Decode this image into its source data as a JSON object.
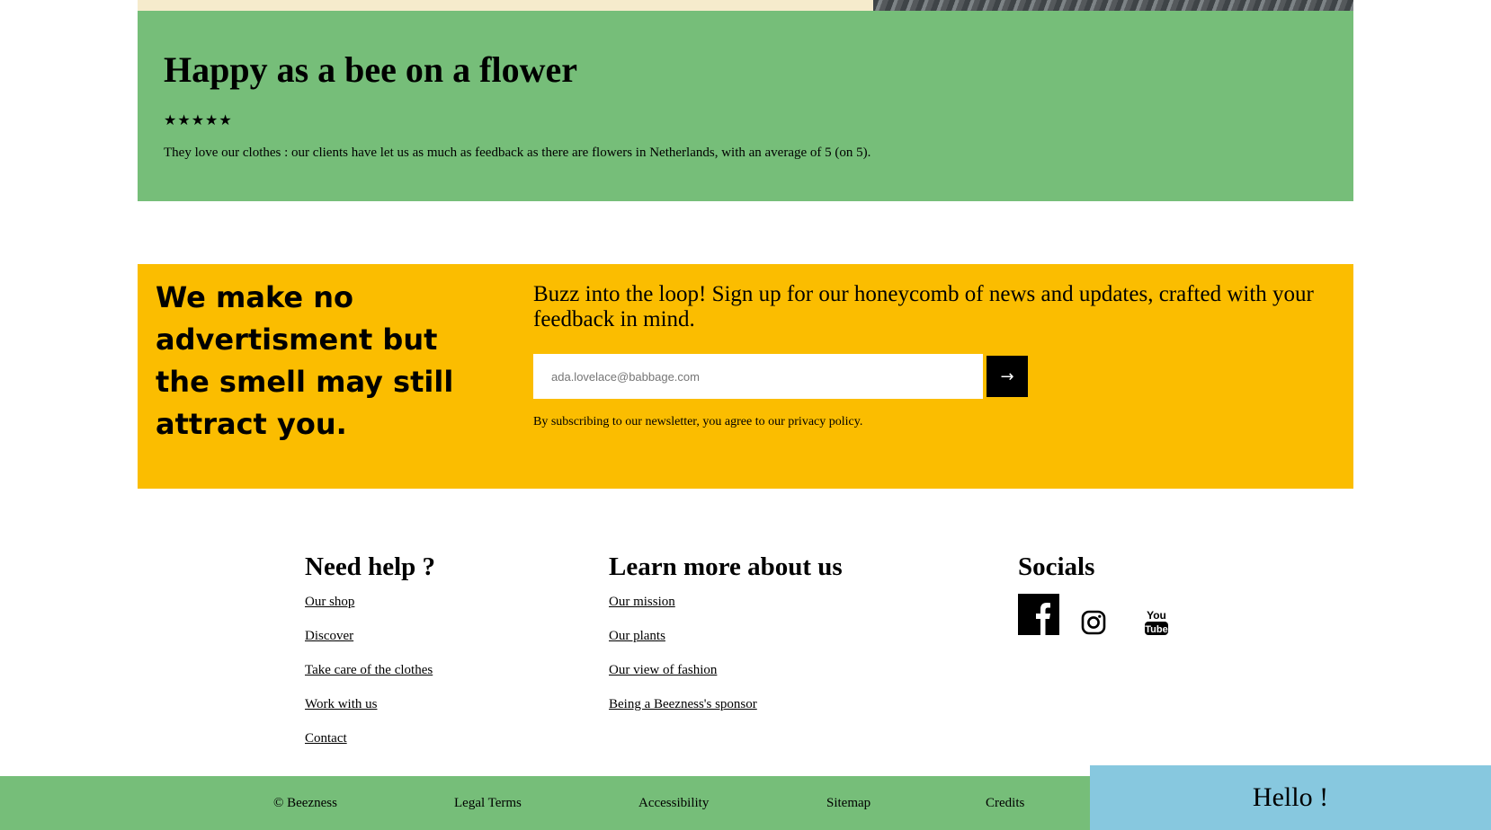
{
  "review": {
    "title": "Happy as a bee on a flower",
    "rating": 5,
    "stars": "★★★★★",
    "text": "They love our clothes : our clients have let us as much as feedback as there are flowers in Netherlands, with an average of 5 (on 5)."
  },
  "newsletter": {
    "headline": "We make no advertisment but the smell may still attract you.",
    "pitch": "Buzz into the loop! Sign up for our honeycomb of news and updates, crafted with your feedback in mind.",
    "email_placeholder": "ada.lovelace@babbage.com",
    "email_value": "",
    "submit_label": "→",
    "note": "By subscribing to our newsletter, you agree to our privacy policy."
  },
  "help": {
    "title": "Need help ?",
    "links": [
      "Our shop",
      "Discover",
      "Take care of the clothes",
      "Work with us",
      "Contact"
    ]
  },
  "learn": {
    "title": "Learn more about us",
    "links": [
      "Our mission",
      "Our plants",
      "Our view of fashion",
      "Being a Beezness's sponsor"
    ]
  },
  "socials": {
    "title": "Socials",
    "icons": [
      "facebook-icon",
      "instagram-icon",
      "youtube-icon"
    ],
    "youtube_text_top": "You",
    "youtube_text_bottom": "Tube"
  },
  "footer": {
    "copyright": "© Beezness",
    "links": [
      "Legal Terms",
      "Accessibility",
      "Sitemap",
      "Credits"
    ]
  },
  "hello_label": "Hello !",
  "colors": {
    "green": "#76be79",
    "yellow": "#fbbd00",
    "cream": "#f6ebcc",
    "light_blue": "#87c8df"
  }
}
